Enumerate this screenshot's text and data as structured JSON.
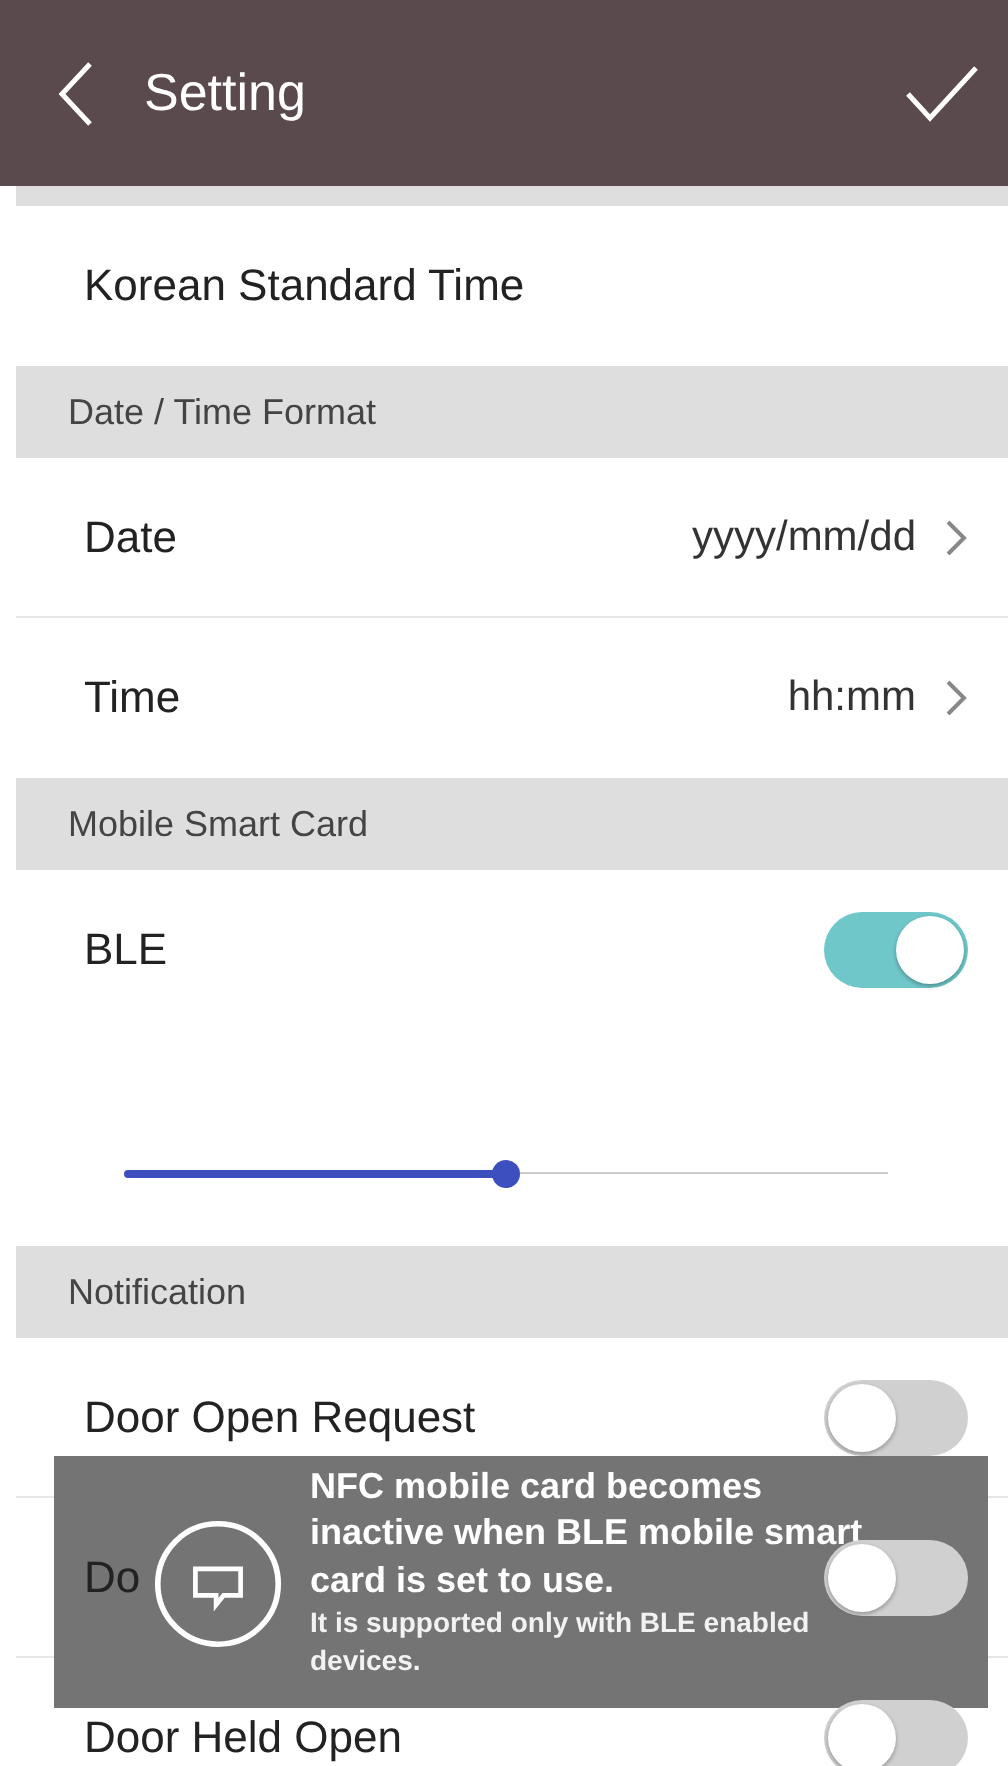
{
  "header": {
    "title": "Setting"
  },
  "time_zone": {
    "value": "Korean Standard Time"
  },
  "date_time_format": {
    "header": "Date / Time Format",
    "rows": [
      {
        "label": "Date",
        "value": "yyyy/mm/dd"
      },
      {
        "label": "Time",
        "value": "hh:mm"
      }
    ]
  },
  "mobile_smart_card": {
    "header": "Mobile Smart Card",
    "ble": {
      "label": "BLE",
      "on": true
    },
    "slider": {
      "level": 0.5
    }
  },
  "notification": {
    "header": "Notification",
    "rows": [
      {
        "label": "Door Open Request",
        "on": false
      },
      {
        "label": "Do",
        "on": false
      },
      {
        "label": "Door Held Open",
        "on": false
      }
    ]
  },
  "toast": {
    "message": "NFC mobile card becomes inactive when BLE mobile smart card is set to use.",
    "note": "It is supported only with BLE enabled devices."
  }
}
